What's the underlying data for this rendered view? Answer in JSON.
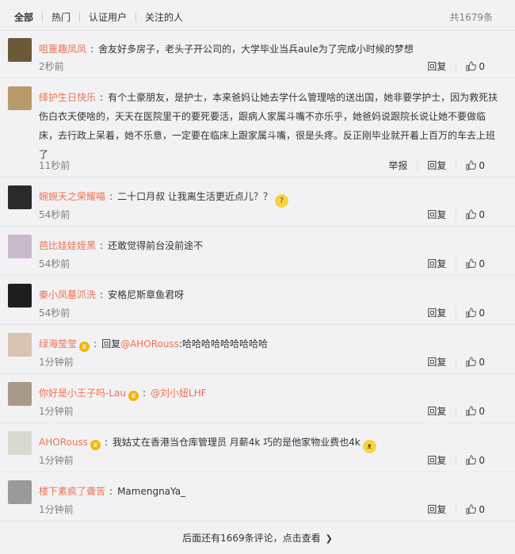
{
  "filters": {
    "tabs": [
      "全部",
      "热门",
      "认证用户",
      "关注的人"
    ],
    "total": "共1679条"
  },
  "actions": {
    "report": "举报",
    "reply": "回复",
    "like_icon": "thumbs-up-icon"
  },
  "comments": [
    {
      "user": "咀噩趣凤凤",
      "text": "舍友好多房子，老头子开公司的，大学毕业当兵aule为了完成小时候的梦想",
      "time": "2秒前",
      "likes": "0",
      "avatar_color": "#6b5a3a"
    },
    {
      "user": "绎护生日快乐",
      "text": "有个土豪朋友，是护士，本来爸妈让她去学什么管理啥的送出国，她非要学护士，因为救死扶伤白衣天使啥的，天天在医院里干的要死要活，跟病人家属斗嘴不亦乐乎，她爸妈说跟院长说让她不要做临床，去行政上呆着，她不乐意，一定要在临床上跟家属斗嘴，很是头疼。反正刚毕业就开着上百万的车去上班了",
      "time": "11秒前",
      "likes": "0",
      "avatar_color": "#b99a6a"
    },
    {
      "user": "婉婉天之荣耀喵",
      "text": "二十口月叔 让我离生活更近点儿？？",
      "time": "54秒前",
      "likes": "0",
      "avatar_color": "#2a2a2a",
      "emoji": "thinking-face"
    },
    {
      "user": "芭比娃娃姪黑",
      "text": "还敢觉得前台没前途不",
      "time": "54秒前",
      "likes": "0",
      "avatar_color": "#c9b8c9"
    },
    {
      "user": "秦小凤墓沠洗",
      "text": "安格尼斯章鱼君呀",
      "time": "54秒前",
      "likes": "0",
      "avatar_color": "#1e1e1e"
    },
    {
      "user": "绿海莹莹",
      "crown": true,
      "reply_prefix": "回复",
      "mention": "@AHORouss",
      "text": ":哈哈哈哈哈哈哈哈哈",
      "time": "1分钟前",
      "likes": "0",
      "avatar_color": "#d8c4b0"
    },
    {
      "user": "你好是小王子吗-Lau",
      "crown": true,
      "mention": "@刘小妞LHF",
      "text": "",
      "time": "1分钟前",
      "likes": "0",
      "avatar_color": "#a89a88"
    },
    {
      "user": "AHORouss",
      "crown": true,
      "text": "我姑丈在香港当仓库管理员 月薪4k 巧的是他家物业费也4k",
      "time": "1分钟前",
      "likes": "0",
      "avatar_color": "#d9d9cf",
      "emoji": "cat-face"
    },
    {
      "user": "楼下素疯了聋苦",
      "text": "MamengnaYa_",
      "time": "1分钟前",
      "likes": "0",
      "avatar_color": "#9a9a9a"
    }
  ],
  "footer": {
    "more_text": "后面还有1669条评论，点击查看"
  }
}
